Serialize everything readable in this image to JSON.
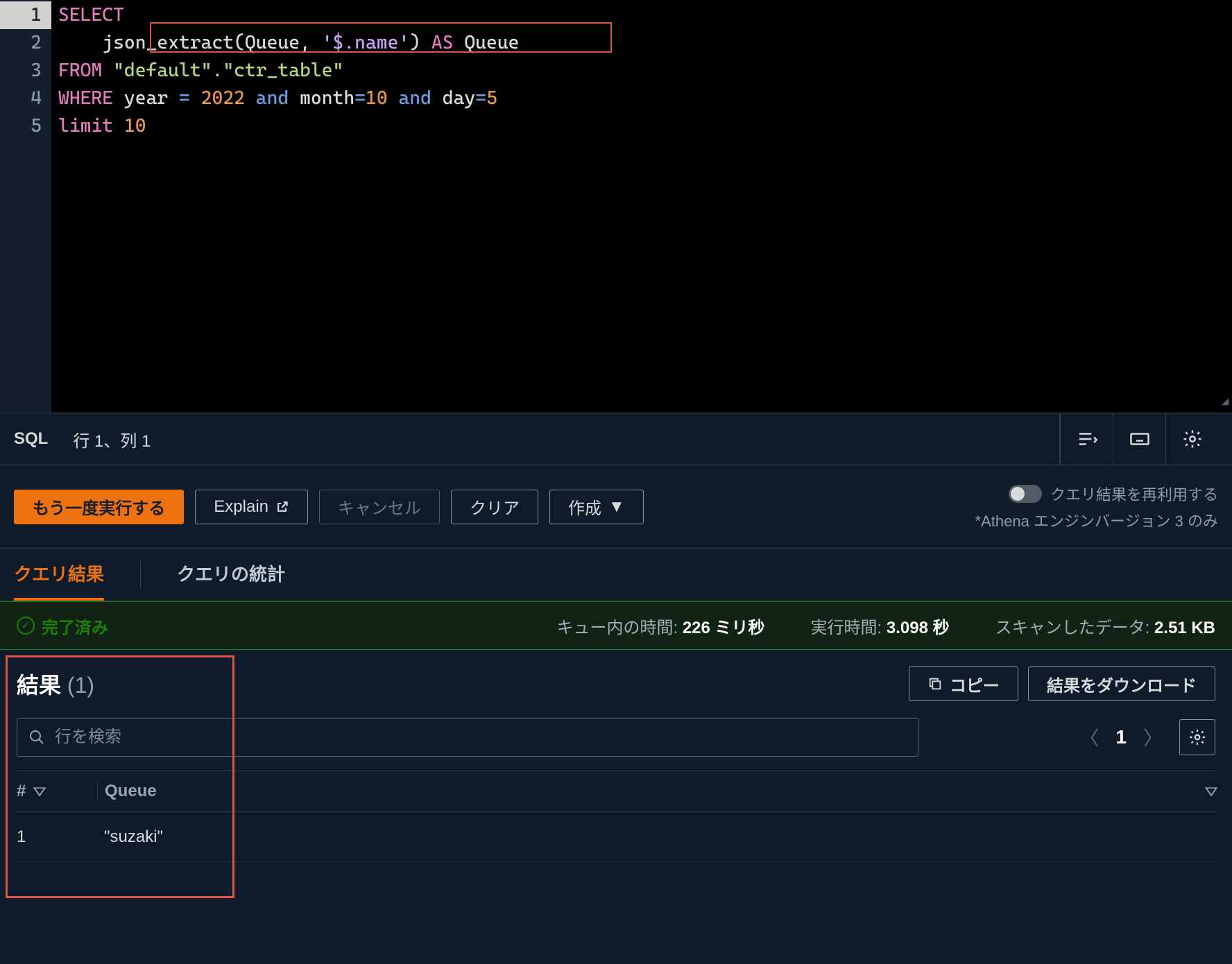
{
  "editor": {
    "lines": [
      "1",
      "2",
      "3",
      "4",
      "5"
    ],
    "code": {
      "l1": {
        "t1": "SELECT"
      },
      "l2": {
        "t1": "json_extract",
        "t2": "(Queue, ",
        "t3": "'$.name'",
        "t4": ") ",
        "t5": "AS",
        "t6": " Queue"
      },
      "l3": {
        "t1": "FROM",
        "t2": " ",
        "t3": "\"default\"",
        "t4": ".",
        "t5": "\"ctr_table\""
      },
      "l4": {
        "t1": "WHERE",
        "t2": " year ",
        "t3": "=",
        "t4": " ",
        "t5": "2022",
        "t6": " ",
        "t7": "and",
        "t8": " month",
        "t9": "=",
        "t10": "10",
        "t11": " ",
        "t12": "and",
        "t13": " day",
        "t14": "=",
        "t15": "5"
      },
      "l5": {
        "t1": "limit",
        "t2": " ",
        "t3": "10"
      }
    }
  },
  "status_bar": {
    "language": "SQL",
    "cursor": "行 1、列 1"
  },
  "actions": {
    "run_again": "もう一度実行する",
    "explain": "Explain",
    "cancel": "キャンセル",
    "clear": "クリア",
    "create": "作成",
    "reuse_label": "クエリ結果を再利用する",
    "engine_note": "*Athena エンジンバージョン 3 のみ"
  },
  "tabs": {
    "results": "クエリ結果",
    "stats": "クエリの統計"
  },
  "status": {
    "ok": "完了済み",
    "queue_label": "キュー内の時間:",
    "queue_value": "226 ミリ秒",
    "runtime_label": "実行時間:",
    "runtime_value": "3.098 秒",
    "scanned_label": "スキャンしたデータ:",
    "scanned_value": "2.51 KB"
  },
  "results": {
    "title": "結果",
    "count": "(1)",
    "copy": "コピー",
    "download": "結果をダウンロード",
    "search_placeholder": "行を検索",
    "page": "1"
  },
  "table": {
    "header_index": "#",
    "header_col": "Queue",
    "rows": [
      {
        "index": "1",
        "value": "\"suzaki\""
      }
    ]
  }
}
